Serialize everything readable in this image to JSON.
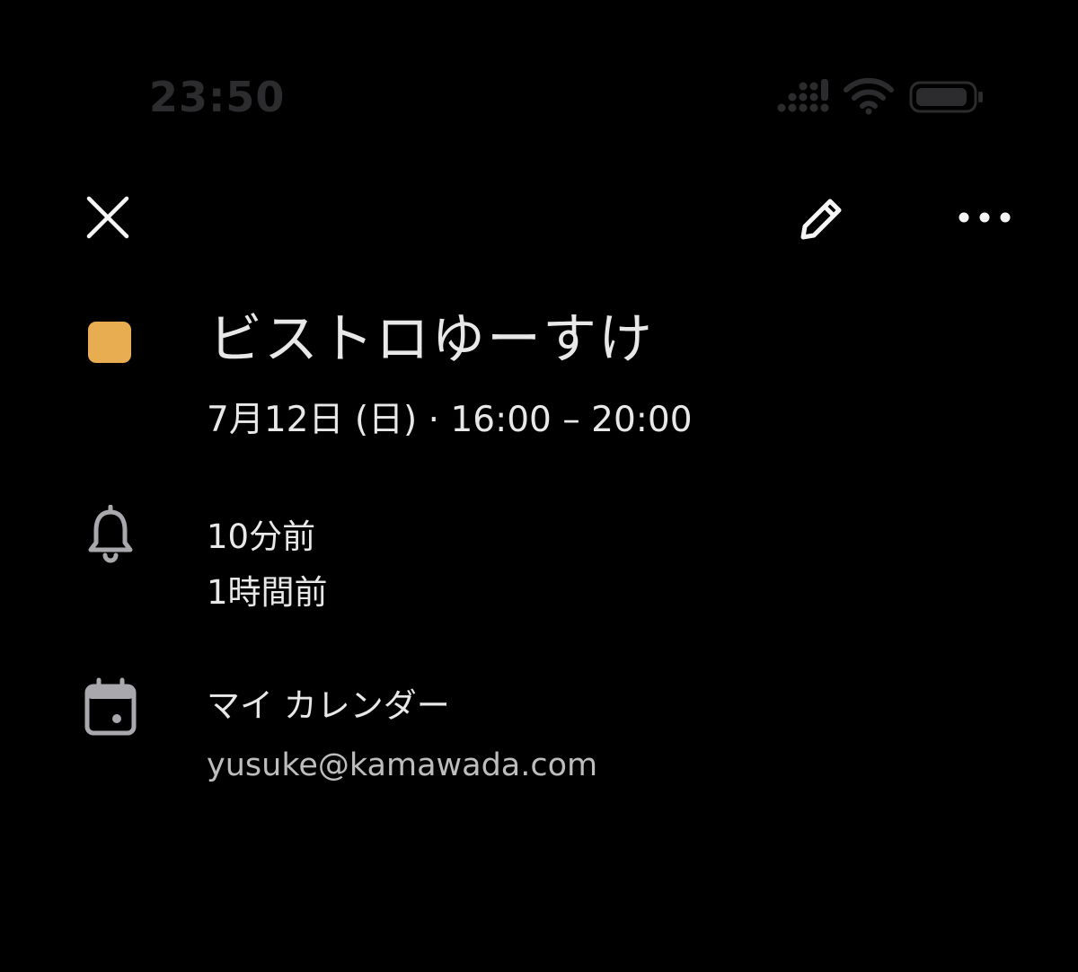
{
  "status_bar": {
    "time": "23:50"
  },
  "toolbar": {
    "close_icon": "close-icon",
    "edit_icon": "pencil-icon",
    "more_icon": "more-horizontal-icon"
  },
  "event": {
    "title": "ビストロゆーすけ",
    "datetime": "7月12日 (日) · 16:00 – 20:00",
    "color": "#e7ad50"
  },
  "reminders": {
    "icon": "bell-icon",
    "items": [
      "10分前",
      "1時間前"
    ]
  },
  "calendar": {
    "icon": "calendar-icon",
    "name": "マイ カレンダー",
    "account": "yusuke@kamawada.com"
  },
  "colors": {
    "background": "#000000",
    "text_primary": "#e8e8e8",
    "text_secondary": "#bdbdbd",
    "icon_gray": "#a8a8ad",
    "status_dim": "#2c2c2e"
  }
}
